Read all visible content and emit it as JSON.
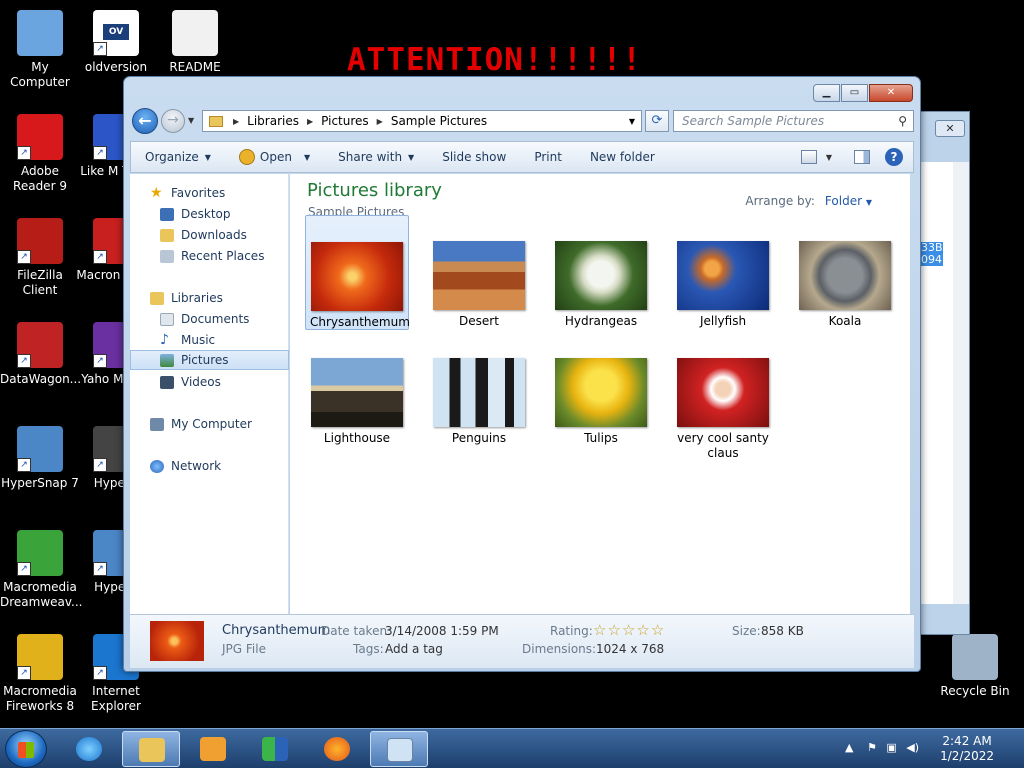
{
  "desktop": {
    "banner": "ATTENTION!!!!!!",
    "icons": [
      {
        "label": "My Computer",
        "color": "#6aa5e0"
      },
      {
        "label": "oldversion",
        "color": "#ffffff"
      },
      {
        "label": "README",
        "color": "#f1f1f1"
      },
      {
        "label": "Adobe Reader 9",
        "color": "#d7191c"
      },
      {
        "label": "Like M Try A",
        "color": "#2c56c8"
      },
      {
        "label": "FileZilla Client",
        "color": "#b51d16"
      },
      {
        "label": "Macron Flash",
        "color": "#c8201e"
      },
      {
        "label": "DataWagon...",
        "color": "#c02323"
      },
      {
        "label": "Yaho Messe",
        "color": "#6a2fa0"
      },
      {
        "label": "HyperSnap 7",
        "color": "#4b86c7"
      },
      {
        "label": "HyperC",
        "color": "#444444"
      },
      {
        "label": "Macromedia Dreamweav...",
        "color": "#3aa33a"
      },
      {
        "label": "HyperS",
        "color": "#4b86c7"
      },
      {
        "label": "Macromedia Fireworks 8",
        "color": "#e0b11a"
      },
      {
        "label": "Internet Explorer",
        "color": "#1b76d0"
      },
      {
        "label": "Recycle Bin",
        "color": "#9fb3c8"
      }
    ],
    "oldversion_tag": "OV",
    "bg_window_text": "33B\n094"
  },
  "window": {
    "address": {
      "crumbs": [
        "Libraries",
        "Pictures",
        "Sample Pictures"
      ]
    },
    "search_placeholder": "Search Sample Pictures",
    "toolbar": {
      "organize": "Organize",
      "open": "Open",
      "share_with": "Share with",
      "slide_show": "Slide show",
      "print": "Print",
      "new_folder": "New folder"
    },
    "nav": {
      "favorites": "Favorites",
      "desktop": "Desktop",
      "downloads": "Downloads",
      "recent": "Recent Places",
      "libraries": "Libraries",
      "documents": "Documents",
      "music": "Music",
      "pictures": "Pictures",
      "videos": "Videos",
      "computer": "My Computer",
      "network": "Network"
    },
    "library_title": "Pictures library",
    "library_sub": "Sample Pictures",
    "arrange_label": "Arrange by:",
    "arrange_value": "Folder",
    "thumbnails": [
      {
        "name": "Chrysanthemum",
        "bg": "radial-gradient(circle at 45% 50%, #fbd26a 0 6%, #f06a1c 22%, #c52a0c 60%, #8e1606)"
      },
      {
        "name": "Desert",
        "bg": "linear-gradient(#4a79c4 0 30%, #c98a52 30% 45%, #a24a1e 45% 70%, #d48a4a 70%)"
      },
      {
        "name": "Hydrangeas",
        "bg": "radial-gradient(circle at 50% 48%, #f3f6f0 0 22%, #d6dcc4 32%, #3f6b2a 55%, #223f14)"
      },
      {
        "name": "Jellyfish",
        "bg": "radial-gradient(circle at 38% 40%, #f3a446 0 10%, #c76a28 16%, #2a58b4 34%, #0c2a78)"
      },
      {
        "name": "Koala",
        "bg": "radial-gradient(circle at 50% 50%, #8a8f94 0 30%, #5c6066 45%, #b5a88d 60%, #6e6152)"
      },
      {
        "name": "Lighthouse",
        "bg": "linear-gradient(#7ca6d4 0 40%, #d8c9a2 40% 48%, #3a3226 48% 78%, #1d1a14 78%)"
      },
      {
        "name": "Penguins",
        "bg": "linear-gradient(90deg, #cfe3f2 0 18%, #1a1a1a 18% 30%, #cfe3f2 30% 46%, #1a1a1a 46% 60%, #dbe9f4 60% 78%, #1a1a1a 78% 88%, #cfe3f2 88%)"
      },
      {
        "name": "Tulips",
        "bg": "radial-gradient(circle at 50% 40%, #fbe14a 0 25%, #e8b410 45%, #6a8a2a 70%, #3d5a18)"
      },
      {
        "name": "very cool santy claus",
        "bg": "radial-gradient(circle at 50% 45%, #f4d2b8 0 12%, #ffffff 20%, #d12222 36%, #7a0f0f)"
      }
    ],
    "details": {
      "name": "Chrysanthemum",
      "type": "JPG File",
      "date_label": "Date taken:",
      "date_value": "3/14/2008 1:59 PM",
      "tags_label": "Tags:",
      "tags_value": "Add a tag",
      "rating_label": "Rating:",
      "rating_value": 0,
      "dimensions_label": "Dimensions:",
      "dimensions_value": "1024 x 768",
      "size_label": "Size:",
      "size_value": "858 KB"
    }
  },
  "taskbar": {
    "time": "2:42 AM",
    "date": "1/2/2022"
  }
}
